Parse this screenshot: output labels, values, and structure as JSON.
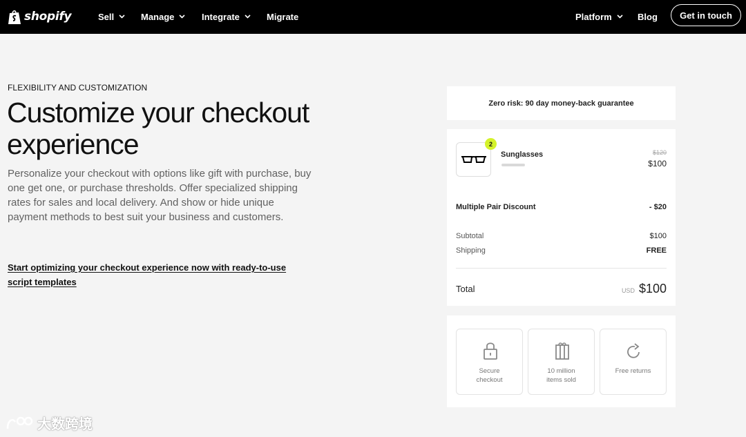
{
  "nav": {
    "logo_text": "shopify",
    "items": [
      {
        "label": "Sell",
        "has_dropdown": true
      },
      {
        "label": "Manage",
        "has_dropdown": true
      },
      {
        "label": "Integrate",
        "has_dropdown": true
      },
      {
        "label": "Migrate",
        "has_dropdown": false
      }
    ],
    "right_items": [
      {
        "label": "Platform",
        "has_dropdown": true
      },
      {
        "label": "Blog",
        "has_dropdown": false
      }
    ],
    "cta_label": "Get in touch"
  },
  "hero": {
    "eyebrow": "FLEXIBILITY AND CUSTOMIZATION",
    "title": "Customize your checkout experience",
    "description": "Personalize your checkout with options like gift with purchase, buy one get one, or purchase thresholds. Offer specialized shipping rates for sales and local delivery. And show or hide unique payment methods to best suit your business and customers.",
    "link_text": "Start optimizing your checkout experience now with ready-to-use script templates"
  },
  "checkout": {
    "guarantee": "Zero risk: 90 day money-back guarantee",
    "item": {
      "name": "Sunglasses",
      "quantity": "2",
      "original_price": "$120",
      "price": "$100"
    },
    "discount": {
      "label": "Multiple Pair Discount",
      "value": "- $20"
    },
    "subtotal": {
      "label": "Subtotal",
      "value": "$100"
    },
    "shipping": {
      "label": "Shipping",
      "value": "FREE"
    },
    "total": {
      "label": "Total",
      "currency": "USD",
      "value": "$100"
    },
    "trust": [
      {
        "label": "Secure checkout",
        "icon": "lock-icon"
      },
      {
        "label": "10 million items sold",
        "icon": "gift-icon"
      },
      {
        "label": "Free returns",
        "icon": "refresh-icon"
      }
    ]
  },
  "colors": {
    "nav_bg": "#000000",
    "page_bg": "#f4f4f4",
    "badge": "#d4f22a"
  },
  "watermark": {
    "text": "大数跨境"
  }
}
